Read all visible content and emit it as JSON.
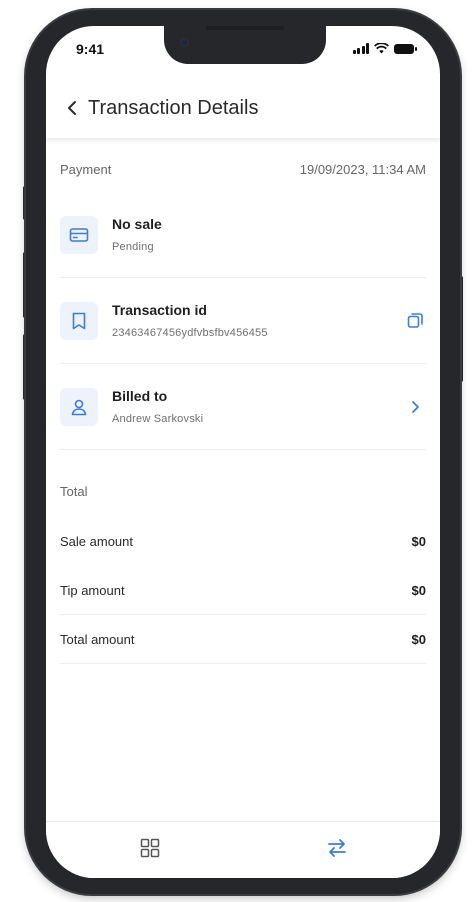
{
  "status_bar": {
    "time": "9:41"
  },
  "header": {
    "title": "Transaction Details"
  },
  "payment": {
    "label": "Payment",
    "date": "19/09/2023, 11:34 AM",
    "items": [
      {
        "title": "No sale",
        "subtitle": "Pending",
        "icon": "credit-card-icon"
      },
      {
        "title": "Transaction id",
        "subtitle": "23463467456ydfvbsfbv456455",
        "icon": "receipt-icon",
        "action_icon": "copy-icon"
      },
      {
        "title": "Billed to",
        "subtitle": "Andrew Sarkovski",
        "icon": "user-icon",
        "action_icon": "chevron-right-icon"
      }
    ]
  },
  "total": {
    "label": "Total",
    "rows": [
      {
        "label": "Sale amount",
        "value": "$0"
      },
      {
        "label": "Tip amount",
        "value": "$0"
      },
      {
        "label": "Total amount",
        "value": "$0"
      }
    ]
  },
  "bottom_nav": {
    "items": [
      "grid-icon",
      "transfer-arrows-icon"
    ]
  },
  "colors": {
    "accent": "#3b7ddd",
    "icon_bg": "#eef2fb",
    "divider": "#eeeeee"
  }
}
